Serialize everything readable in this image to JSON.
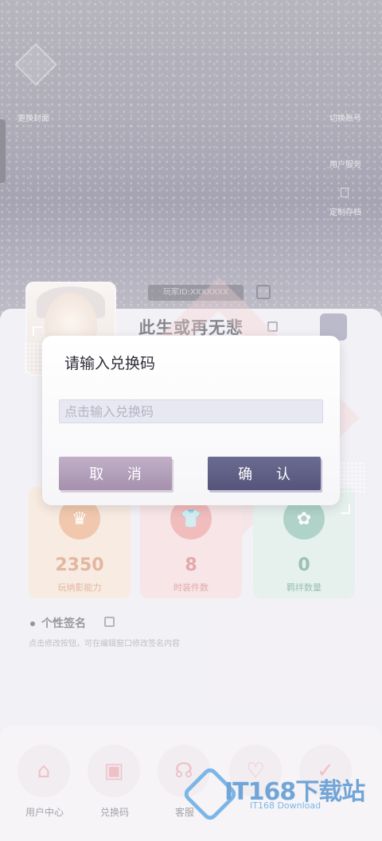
{
  "header": {
    "left_link": "更换封面",
    "right_links": [
      "切换账号",
      "用户服务",
      "定制存档"
    ],
    "id_text": "玩家ID:XXXXXXX"
  },
  "profile": {
    "username": "此生或再无悲"
  },
  "stats": [
    {
      "value": "2350",
      "label": "玩纳影能力",
      "icon": "crown-icon",
      "color": "#e9a77b",
      "bg": "#f3dfd0",
      "text": "#d28a66"
    },
    {
      "value": "8",
      "label": "时装件数",
      "icon": "shirt-icon",
      "color": "#e99394",
      "bg": "#f2d6d8",
      "text": "#d27476"
    },
    {
      "value": "0",
      "label": "羁绊数量",
      "icon": "rose-icon",
      "color": "#7fb9a8",
      "bg": "#d7e7e2",
      "text": "#5d9b89"
    }
  ],
  "signature": {
    "title": "个性签名",
    "hint": "点击修改按钮，可在编辑窗口修改签名内容"
  },
  "bottom_nav": [
    {
      "label": "用户中心",
      "icon": "home-icon"
    },
    {
      "label": "兑换码",
      "icon": "ticket-icon"
    },
    {
      "label": "客服",
      "icon": "headset-icon"
    },
    {
      "label": "",
      "icon": "heart-plus-icon"
    },
    {
      "label": "",
      "icon": "shield-check-icon"
    }
  ],
  "dialog": {
    "title": "请输入兑换码",
    "input_placeholder": "点击输入兑换码",
    "input_value": "",
    "cancel_label": "取 消",
    "confirm_label": "确 认"
  },
  "watermark": {
    "brand": "IT168下载站",
    "sub": "IT168 Download"
  }
}
